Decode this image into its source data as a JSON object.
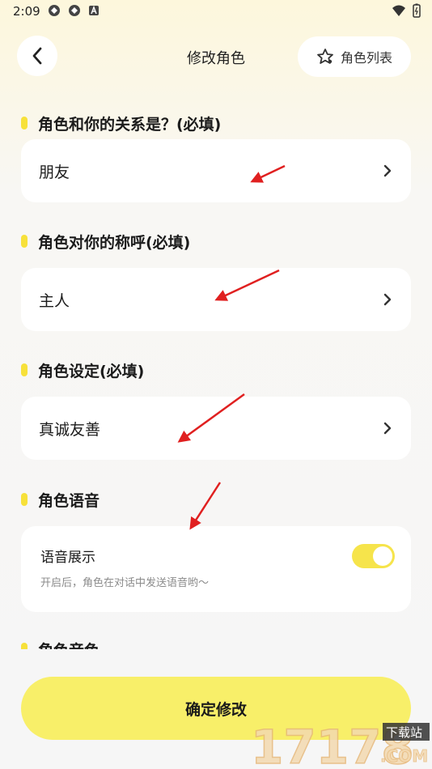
{
  "status_bar": {
    "time": "2:09",
    "icons": [
      "app-notification-icon",
      "app-notification-icon",
      "a-badge-icon",
      "wifi-icon",
      "battery-icon"
    ]
  },
  "header": {
    "back_icon": "chevron-left-icon",
    "title": "修改角色",
    "role_list_label": "角色列表",
    "role_list_icon": "role-star-icon"
  },
  "sections": [
    {
      "title": "角色和你的关系是？(必填)",
      "value": "朋友"
    },
    {
      "title": "角色对你的称呼(必填)",
      "value": "主人"
    },
    {
      "title": "角色设定(必填)",
      "value": "真诚友善"
    }
  ],
  "voice_section": {
    "title": "角色语音",
    "card_title": "语音展示",
    "card_desc": "开启后，角色在对话中发送语音哟～",
    "toggle_on": true
  },
  "cut_section_title": "角色音色",
  "confirm_button": "确定修改",
  "accent_color": "#f7e13a",
  "annotation_color": "#e02020",
  "watermark": {
    "digits": "17178",
    "badge": "下载站",
    "domain": ".COM"
  }
}
